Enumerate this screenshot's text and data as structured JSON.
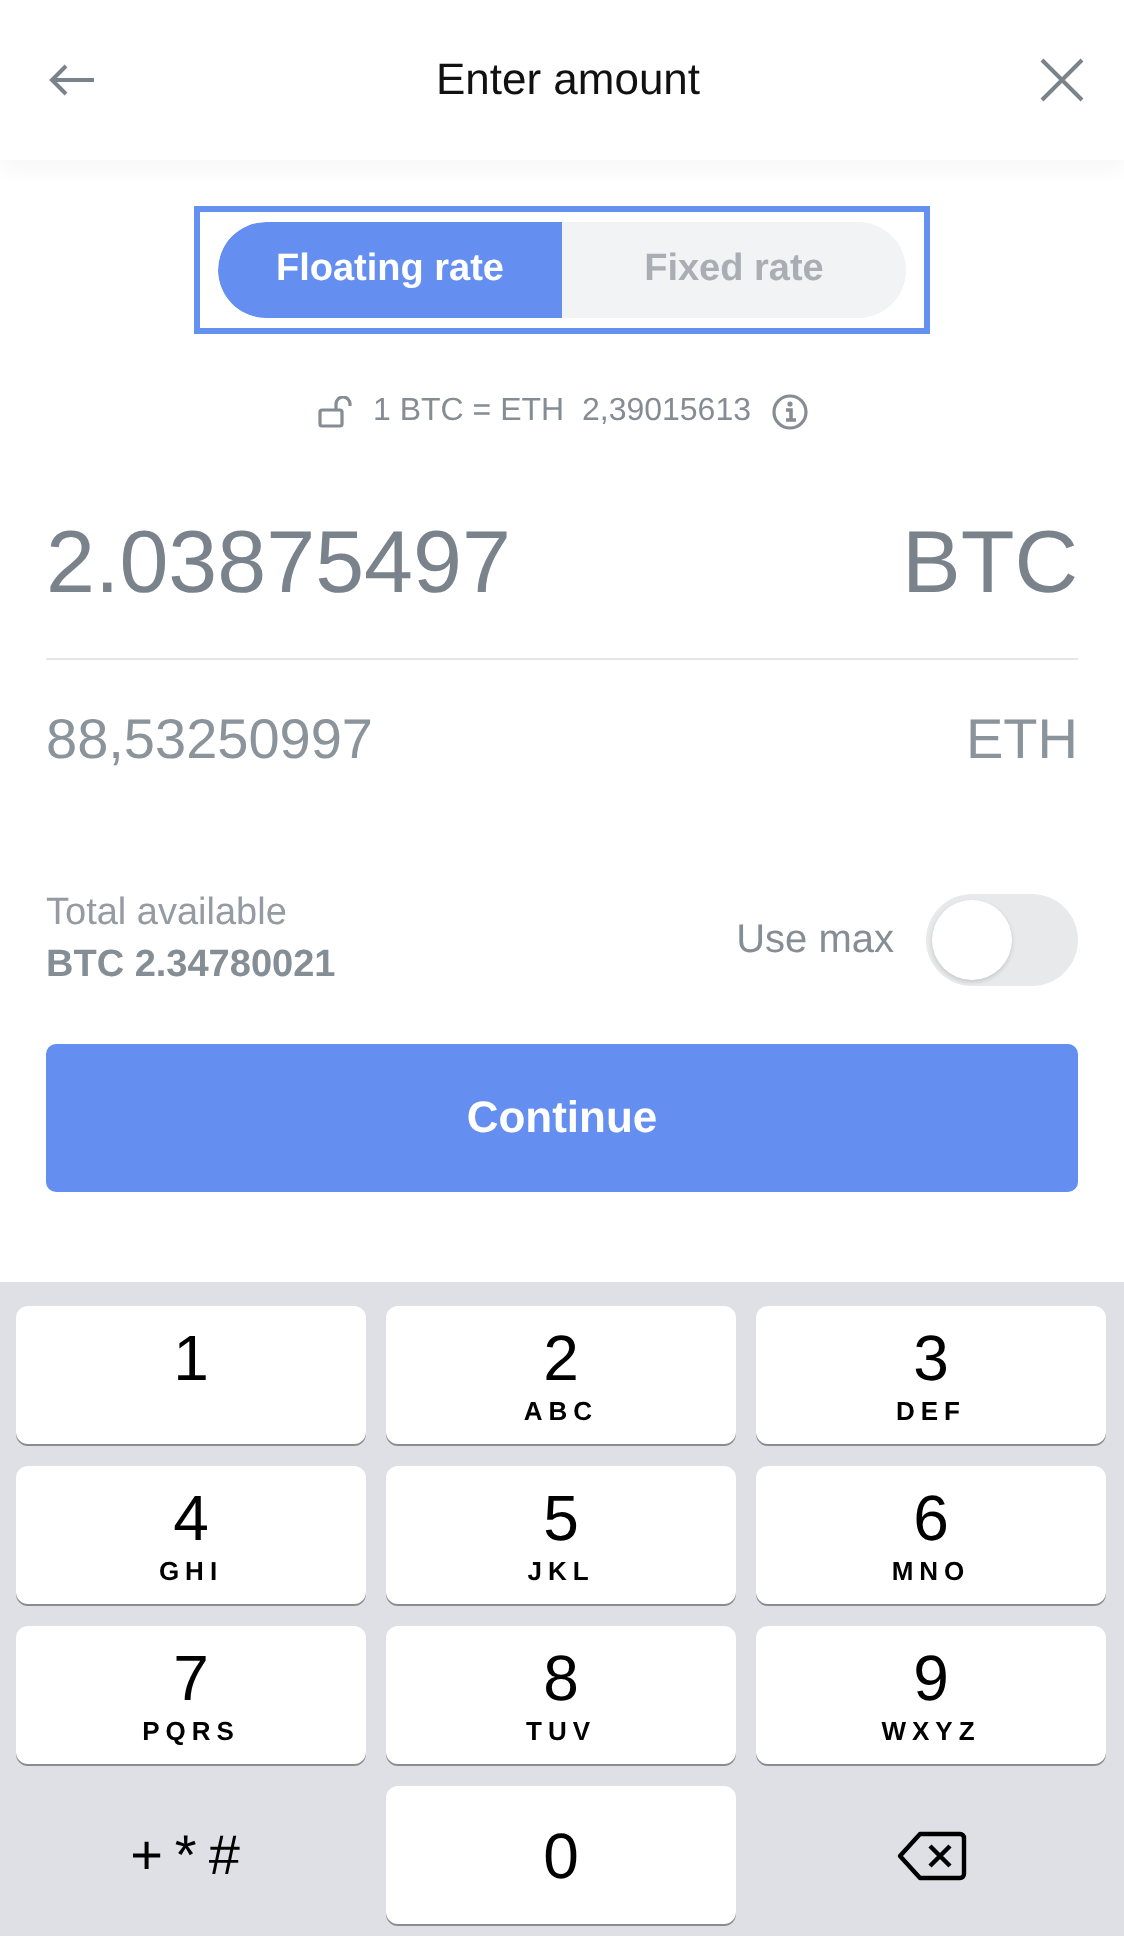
{
  "header": {
    "title": "Enter amount"
  },
  "rate_tabs": [
    {
      "label": "Floating rate",
      "selected": true
    },
    {
      "label": "Fixed rate",
      "selected": false
    }
  ],
  "rate": {
    "text": "1 BTC = ETH  2,39015613"
  },
  "amount": {
    "value": "2.03875497",
    "currency": "BTC"
  },
  "converted": {
    "value": "88,53250997",
    "currency": "ETH"
  },
  "available": {
    "label": "Total available",
    "value": "BTC 2.34780021"
  },
  "use_max": {
    "label": "Use max",
    "on": false
  },
  "continue_button": "Continue",
  "keypad": [
    {
      "kind": "digit",
      "digit": "1"
    },
    {
      "kind": "digit",
      "digit": "2",
      "letters": "ABC"
    },
    {
      "kind": "digit",
      "digit": "3",
      "letters": "DEF"
    },
    {
      "kind": "digit",
      "digit": "4",
      "letters": "GHI"
    },
    {
      "kind": "digit",
      "digit": "5",
      "letters": "JKL"
    },
    {
      "kind": "digit",
      "digit": "6",
      "letters": "MNO"
    },
    {
      "kind": "digit",
      "digit": "7",
      "letters": "PQRS"
    },
    {
      "kind": "digit",
      "digit": "8",
      "letters": "TUV"
    },
    {
      "kind": "digit",
      "digit": "9",
      "letters": "WXYZ"
    },
    {
      "kind": "symbols",
      "digit": "+*#"
    },
    {
      "kind": "digit",
      "digit": "0"
    },
    {
      "kind": "delete"
    }
  ]
}
